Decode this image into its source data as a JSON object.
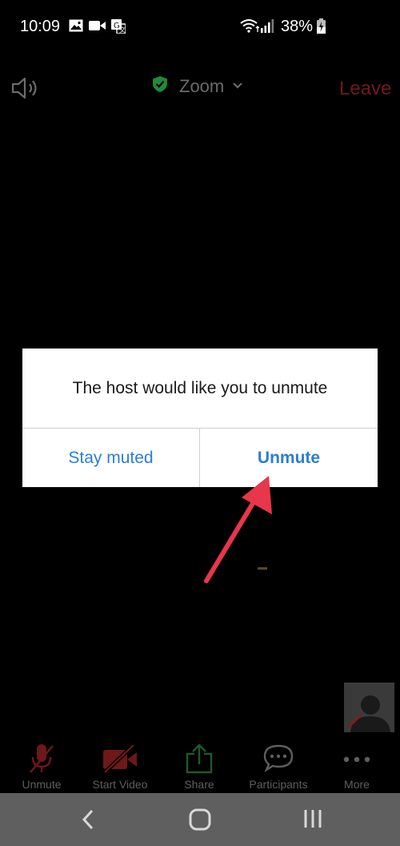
{
  "status_bar": {
    "time": "10:09",
    "battery": "38%",
    "icons": [
      "image-icon",
      "video-camera-icon",
      "translate-icon",
      "wifi-icon",
      "signal-icon",
      "battery-charging-icon"
    ]
  },
  "header": {
    "title": "Zoom",
    "leave_label": "Leave",
    "icons": [
      "speaker-icon",
      "shield-check-icon",
      "chevron-down-icon"
    ]
  },
  "dialog": {
    "message": "The host would like you to unmute",
    "stay_muted_label": "Stay muted",
    "unmute_label": "Unmute"
  },
  "toolbar": {
    "items": [
      {
        "label": "Unmute",
        "icon": "microphone-muted-icon"
      },
      {
        "label": "Start Video",
        "icon": "video-off-icon"
      },
      {
        "label": "Share",
        "icon": "share-icon"
      },
      {
        "label": "Participants",
        "icon": "participants-icon"
      },
      {
        "label": "More",
        "icon": "more-icon"
      }
    ]
  },
  "nav_bar": {
    "icons": [
      "back-icon",
      "home-icon",
      "recents-icon"
    ]
  },
  "colors": {
    "dialog_button": "#2a7ed7",
    "annotation_arrow": "#e8364a",
    "leave": "#6f1a1a",
    "shield": "#1f8a3a"
  }
}
